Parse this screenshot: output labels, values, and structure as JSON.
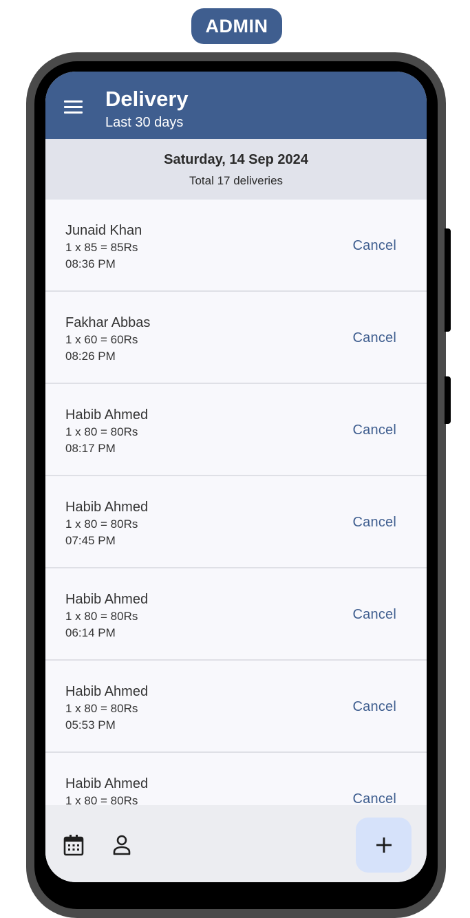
{
  "badge": {
    "label": "ADMIN"
  },
  "appbar": {
    "title": "Delivery",
    "subtitle": "Last 30 days"
  },
  "date_header": {
    "date": "Saturday, 14 Sep 2024",
    "total": "Total 17 deliveries"
  },
  "deliveries": [
    {
      "name": "Junaid Khan",
      "amount": "1 x 85 = 85Rs",
      "time": "08:36 PM",
      "action": "Cancel"
    },
    {
      "name": "Fakhar Abbas",
      "amount": "1 x 60 = 60Rs",
      "time": "08:26 PM",
      "action": "Cancel"
    },
    {
      "name": "Habib Ahmed",
      "amount": "1 x 80 = 80Rs",
      "time": "08:17 PM",
      "action": "Cancel"
    },
    {
      "name": "Habib Ahmed",
      "amount": "1 x 80 = 80Rs",
      "time": "07:45 PM",
      "action": "Cancel"
    },
    {
      "name": "Habib Ahmed",
      "amount": "1 x 80 = 80Rs",
      "time": "06:14 PM",
      "action": "Cancel"
    },
    {
      "name": "Habib Ahmed",
      "amount": "1 x 80 = 80Rs",
      "time": "05:53 PM",
      "action": "Cancel"
    },
    {
      "name": "Habib Ahmed",
      "amount": "1 x 80 = 80Rs",
      "time": "",
      "action": "Cancel"
    }
  ],
  "bottom_nav": {
    "items": [
      {
        "icon": "calendar-icon"
      },
      {
        "icon": "person-icon"
      }
    ],
    "fab_icon": "plus-icon"
  },
  "colors": {
    "primary": "#3f5e8f",
    "header_band": "#e1e3eb",
    "list_bg": "#f8f8fc",
    "fab_bg": "#d6e2fa",
    "bottom_bar": "#ecedf1"
  }
}
